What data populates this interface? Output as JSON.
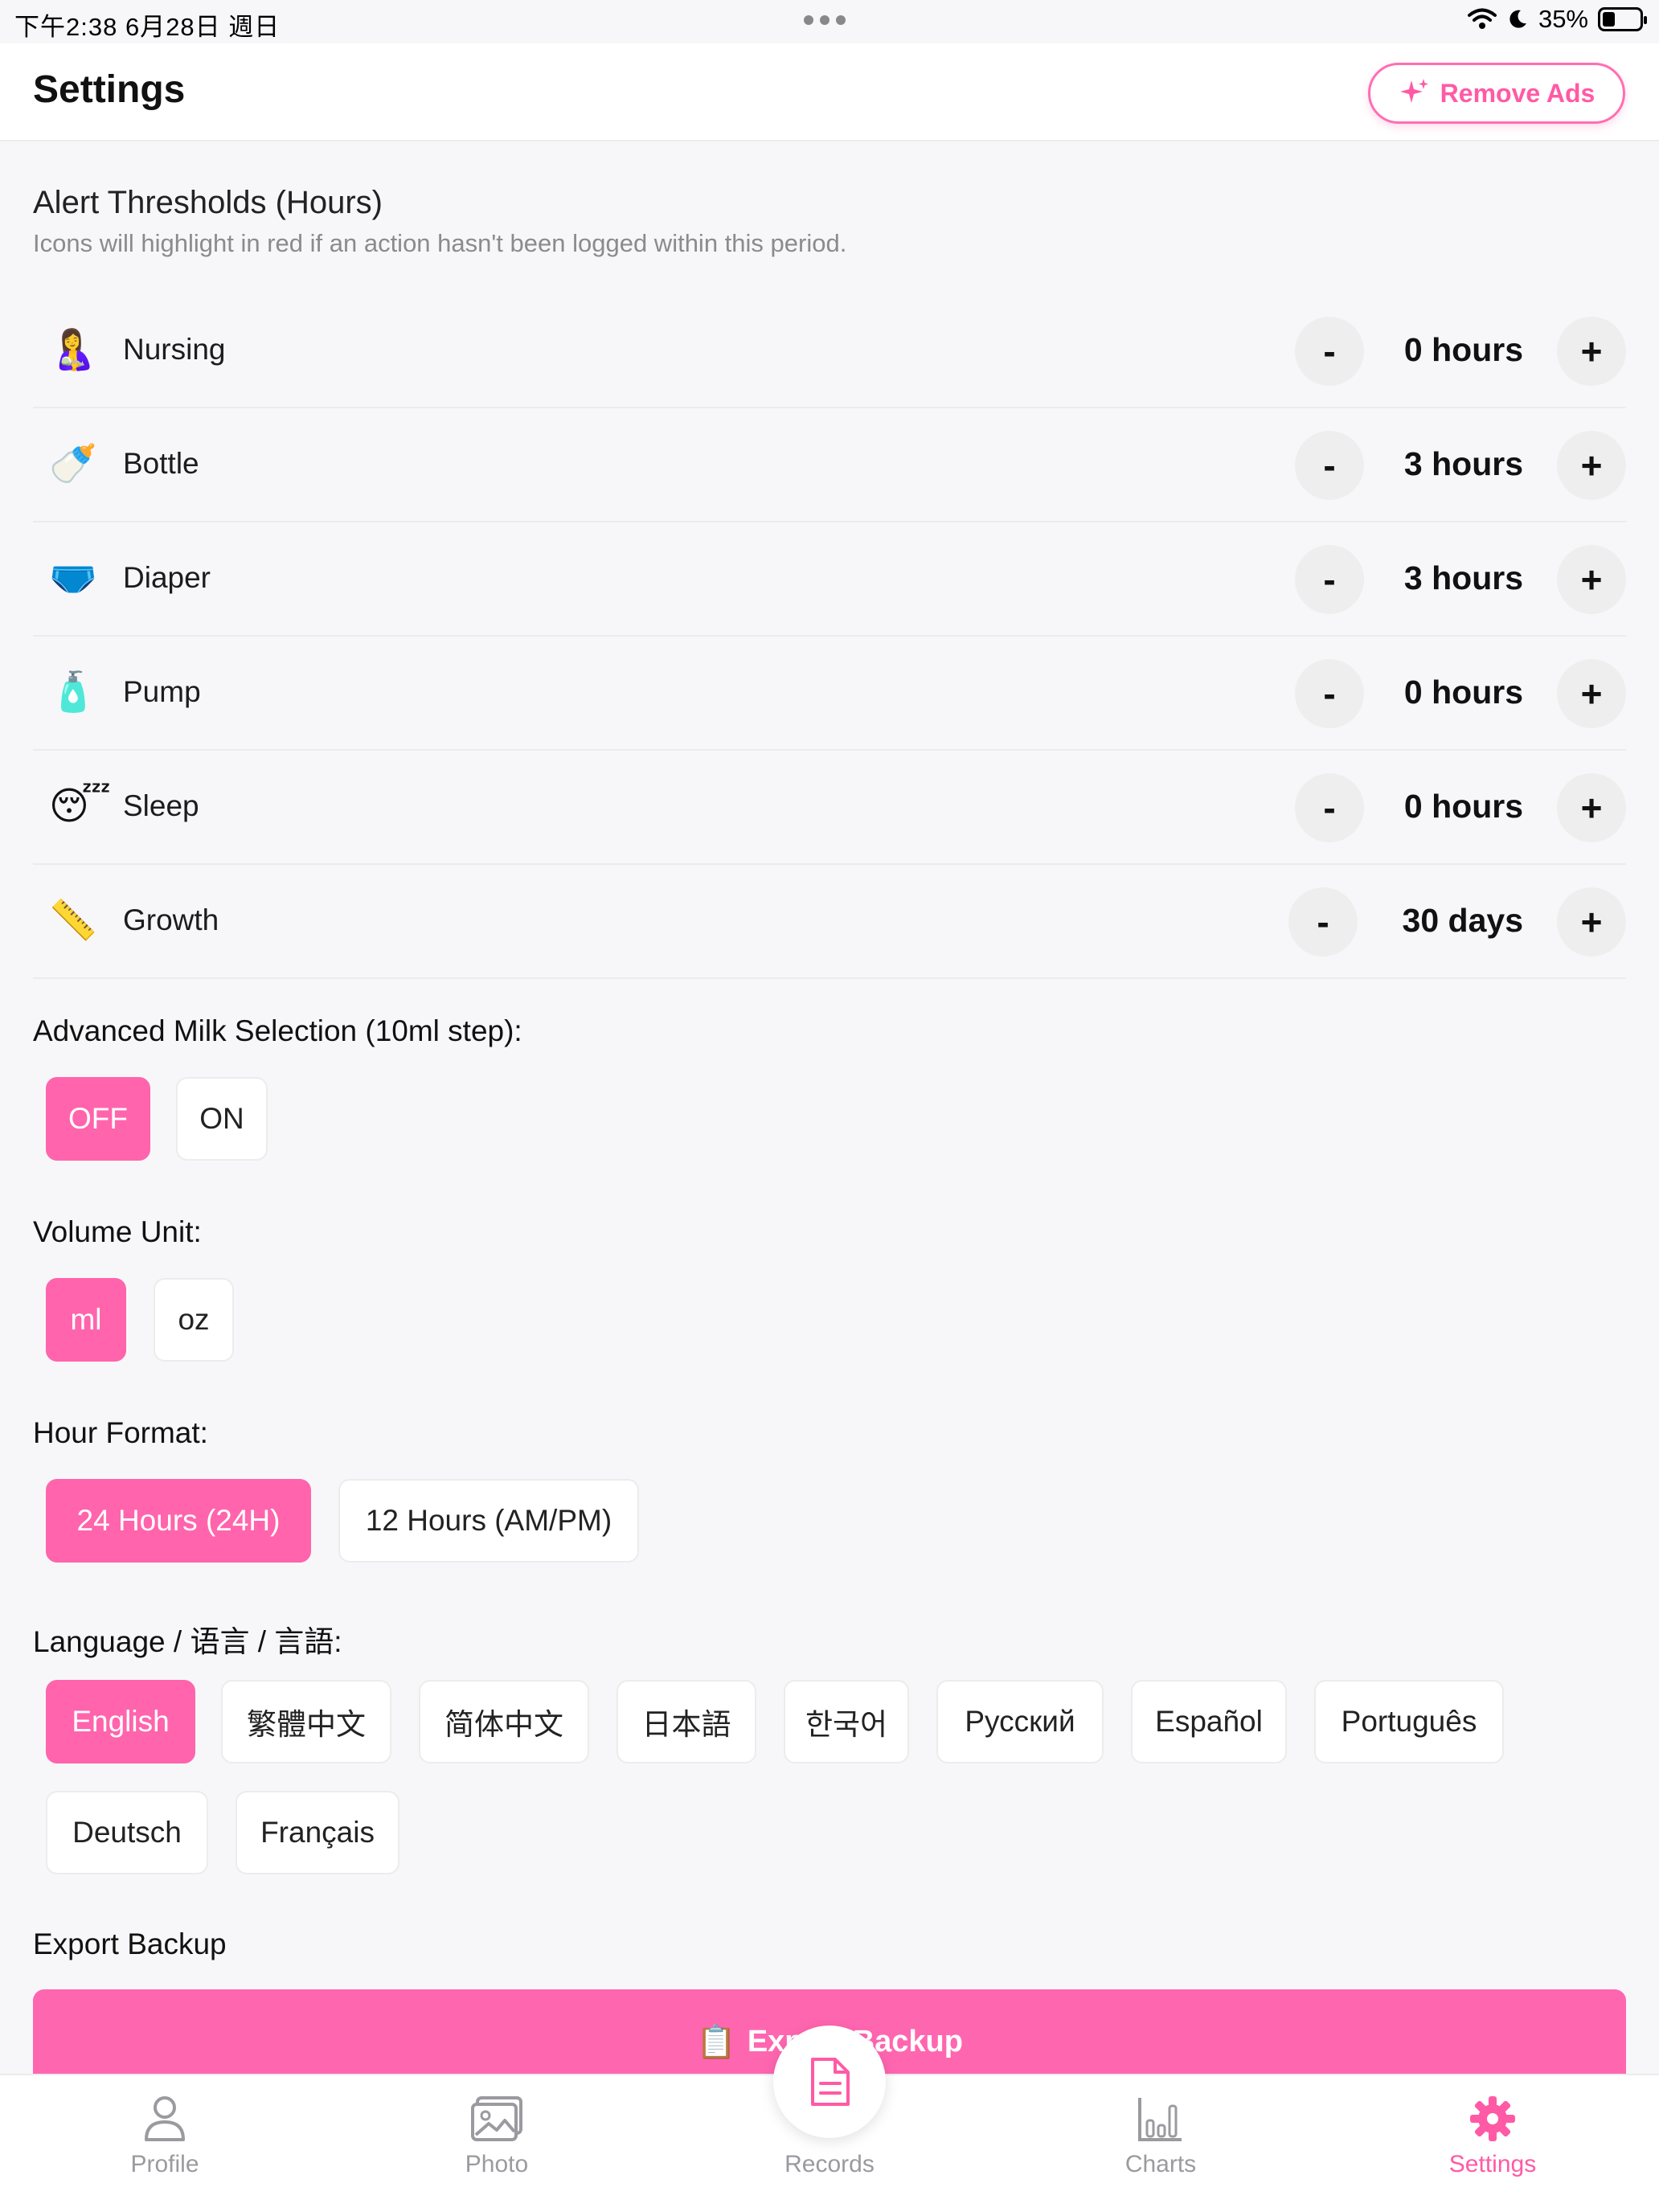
{
  "status_bar": {
    "time_date": "下午2:38   6月28日 週日",
    "battery": "35%",
    "battery_level": 0.35
  },
  "header": {
    "title": "Settings",
    "remove_ads": "Remove Ads"
  },
  "alert_thresholds": {
    "title": "Alert Thresholds (Hours)",
    "subtitle": "Icons will highlight in red if an action hasn't been logged within this period.",
    "decrement_label": "-",
    "increment_label": "+",
    "items": [
      {
        "label": "Nursing",
        "value": "0 hours",
        "icon": "nursing-icon",
        "glyph": "🤱"
      },
      {
        "label": "Bottle",
        "value": "3 hours",
        "icon": "bottle-icon",
        "glyph": "🍼"
      },
      {
        "label": "Diaper",
        "value": "3 hours",
        "icon": "diaper-icon",
        "glyph": "🩲"
      },
      {
        "label": "Pump",
        "value": "0 hours",
        "icon": "pump-icon",
        "glyph": "🧴"
      },
      {
        "label": "Sleep",
        "value": "0 hours",
        "icon": "sleep-icon",
        "glyph": "😴"
      },
      {
        "label": "Growth",
        "value": "30 days",
        "icon": "ruler-icon",
        "glyph": "📏"
      }
    ]
  },
  "advanced_milk": {
    "label": "Advanced Milk Selection (10ml step):",
    "options": [
      "OFF",
      "ON"
    ],
    "selected": "OFF"
  },
  "volume_unit": {
    "label": "Volume Unit:",
    "options": [
      "ml",
      "oz"
    ],
    "selected": "ml"
  },
  "hour_format": {
    "label": "Hour Format:",
    "options": [
      "24 Hours (24H)",
      "12 Hours (AM/PM)"
    ],
    "selected": "24 Hours (24H)"
  },
  "language": {
    "label": "Language / 语言 / 言語:",
    "options": [
      "English",
      "繁體中文",
      "简体中文",
      "日本語",
      "한국어",
      "Русский",
      "Español",
      "Português",
      "Deutsch",
      "Français"
    ],
    "selected": "English"
  },
  "export": {
    "label": "Export Backup",
    "button": "Export Backup"
  },
  "tabbar": {
    "tabs": [
      {
        "label": "Profile",
        "icon": "person-icon"
      },
      {
        "label": "Photo",
        "icon": "photo-icon"
      },
      {
        "label": "Records",
        "icon": "document-icon"
      },
      {
        "label": "Charts",
        "icon": "bar-chart-icon"
      },
      {
        "label": "Settings",
        "icon": "gear-icon"
      }
    ],
    "active": "Settings"
  },
  "colors": {
    "accent": "#ff64ac",
    "inactive_tab": "#9a9a9f"
  }
}
